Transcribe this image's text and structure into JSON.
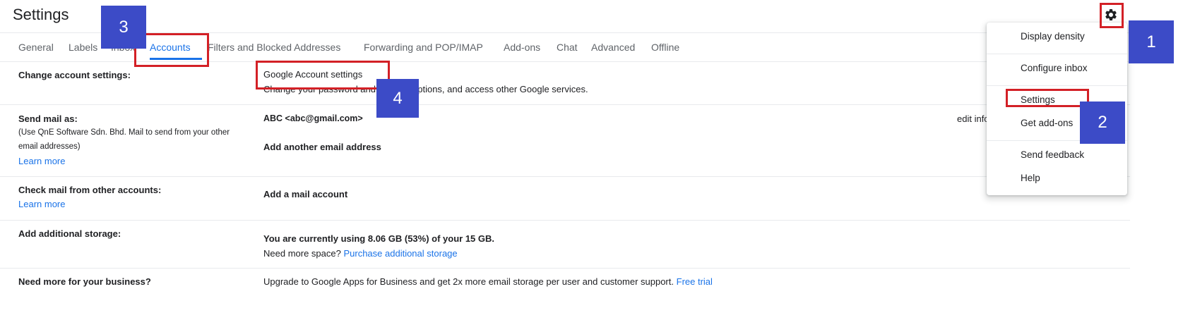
{
  "header": {
    "title": "Settings"
  },
  "tabs": [
    {
      "label": "General"
    },
    {
      "label": "Labels"
    },
    {
      "label": "Inbox"
    },
    {
      "label": "Accounts"
    },
    {
      "label": "Filters and Blocked Addresses"
    },
    {
      "label": "Forwarding and POP/IMAP"
    },
    {
      "label": "Add-ons"
    },
    {
      "label": "Chat"
    },
    {
      "label": "Advanced"
    },
    {
      "label": "Offline"
    }
  ],
  "rows": {
    "change_account": {
      "label": "Change account settings:",
      "link": "Google Account settings",
      "description": "Change your password and security options, and access other Google services."
    },
    "send_mail": {
      "label": "Send mail as:",
      "note_line1": "(Use QnE Software Sdn. Bhd. Mail to send from your other",
      "note_line2": "email addresses)",
      "learn_more": "Learn more",
      "address": "ABC <abc@gmail.com>",
      "add_address": "Add another email address",
      "edit_info": "edit info"
    },
    "check_mail": {
      "label": "Check mail from other accounts:",
      "learn_more": "Learn more",
      "add_account": "Add a mail account"
    },
    "storage": {
      "label": "Add additional storage:",
      "usage": "You are currently using 8.06 GB (53%) of your 15 GB.",
      "more_space": "Need more space?",
      "purchase": "Purchase additional storage"
    },
    "business": {
      "label": "Need more for your business?",
      "text": "Upgrade to Google Apps for Business and get 2x more email storage per user and customer support.",
      "trial": "Free trial"
    }
  },
  "menu": {
    "items": [
      {
        "label": "Display density"
      },
      {
        "label": "Configure inbox"
      },
      {
        "label": "Settings"
      },
      {
        "label": "Get add-ons"
      },
      {
        "label": "Send feedback"
      },
      {
        "label": "Help"
      }
    ]
  },
  "annotations": {
    "badges": [
      "1",
      "2",
      "3",
      "4"
    ],
    "badge_color": "#3c4bc7",
    "highlight_color": "#d32026"
  },
  "icons": {
    "gear": "gear-icon"
  },
  "colors": {
    "accent": "#1a73e8",
    "link_bold": "#1f5ba8"
  }
}
